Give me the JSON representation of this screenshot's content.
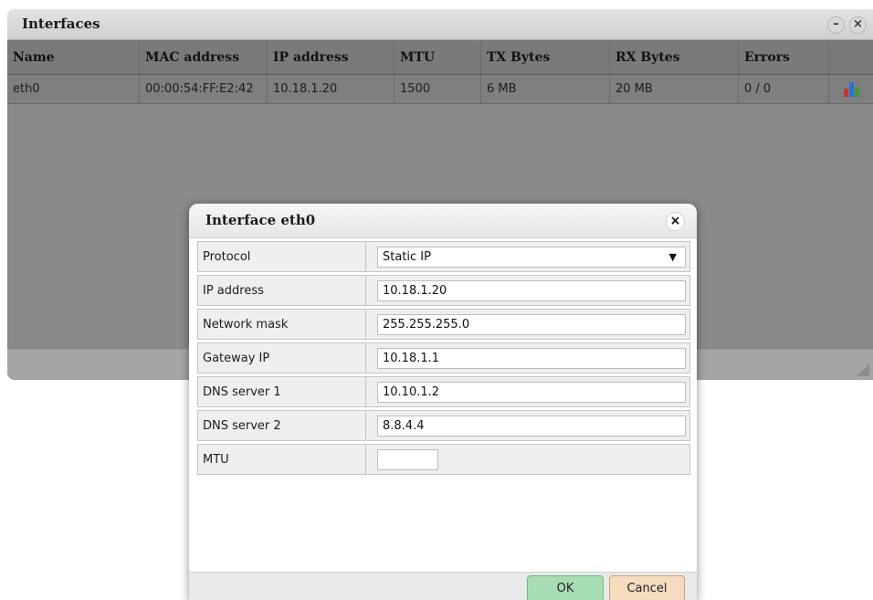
{
  "window": {
    "title": "Interfaces"
  },
  "table": {
    "headers": [
      "Name",
      "MAC address",
      "IP address",
      "MTU",
      "TX Bytes",
      "RX Bytes",
      "Errors"
    ],
    "rows": [
      {
        "name": "eth0",
        "mac": "00:00:54:FF:E2:42",
        "ip": "10.18.1.20",
        "mtu": "1500",
        "tx": "6 MB",
        "rx": "20 MB",
        "errors": "0 / 0",
        "action_icon": "bar-chart-icon"
      }
    ]
  },
  "dialog": {
    "title": "Interface eth0",
    "fields": [
      {
        "label": "Protocol",
        "value": "Static IP",
        "type": "select"
      },
      {
        "label": "IP address",
        "value": "10.18.1.20"
      },
      {
        "label": "Network mask",
        "value": "255.255.255.0"
      },
      {
        "label": "Gateway IP",
        "value": "10.18.1.1"
      },
      {
        "label": "DNS server 1",
        "value": "10.10.1.2"
      },
      {
        "label": "DNS server 2",
        "value": "8.8.4.4"
      },
      {
        "label": "MTU",
        "value": ""
      }
    ],
    "ok_label": "OK",
    "cancel_label": "Cancel"
  },
  "colors": {
    "ok_button": "#a8dcb4",
    "cancel_button": "#f5dcc0",
    "chart_red": "#c0392b",
    "chart_blue": "#2e6fd1",
    "chart_green": "#3c9a3c"
  }
}
